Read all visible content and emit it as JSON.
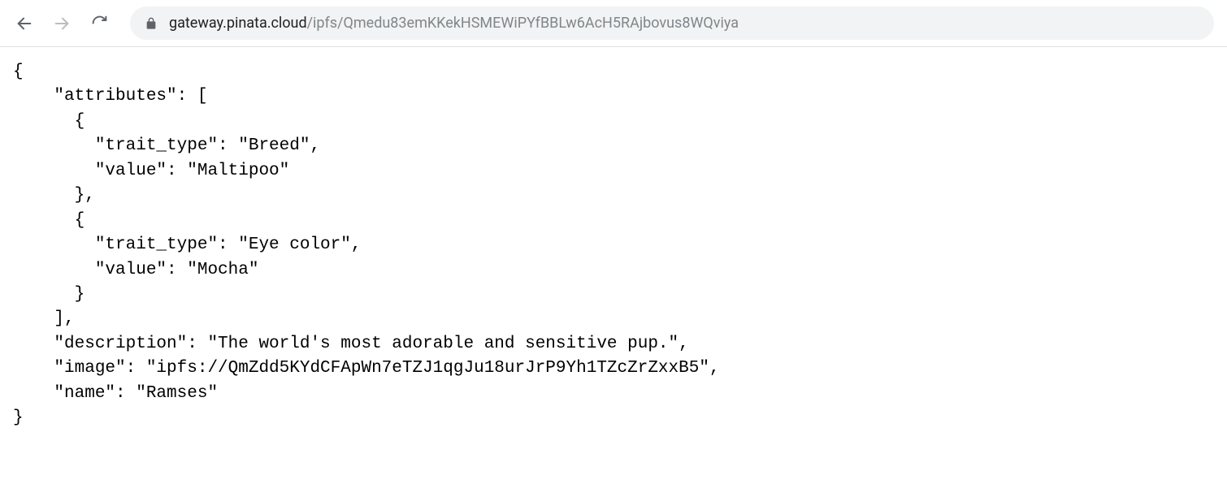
{
  "url": {
    "domain": "gateway.pinata.cloud",
    "path": "/ipfs/Qmedu83emKKekHSMEWiPYfBBLw6AcH5RAjbovus8WQviya"
  },
  "json_content": {
    "attributes": [
      {
        "trait_type": "Breed",
        "value": "Maltipoo"
      },
      {
        "trait_type": "Eye color",
        "value": "Mocha"
      }
    ],
    "description": "The world's most adorable and sensitive pup.",
    "image": "ipfs://QmZdd5KYdCFApWn7eTZJ1qgJu18urJrP9Yh1TZcZrZxxB5",
    "name": "Ramses"
  }
}
